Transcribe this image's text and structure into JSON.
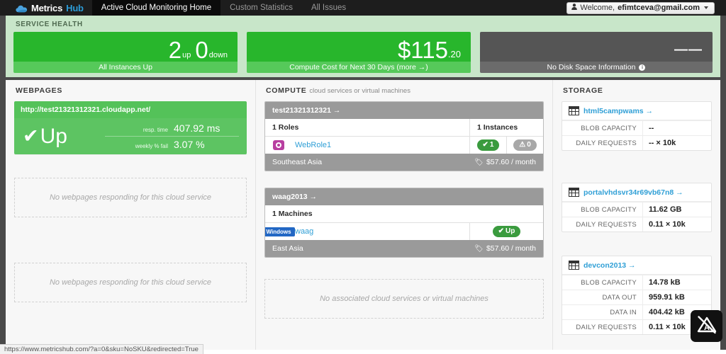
{
  "nav": {
    "brand": "Metrics",
    "brand_accent": "Hub",
    "brand_icon": "cloud-icon",
    "items": [
      {
        "label": "Active Cloud Monitoring Home",
        "active": true
      },
      {
        "label": "Custom Statistics",
        "active": false
      },
      {
        "label": "All Issues",
        "active": false
      }
    ],
    "user": {
      "greeting": "Welcome,",
      "email": "efimtceva@gmail.com",
      "icon": "user-icon"
    }
  },
  "service_health": {
    "title": "SERVICE HEALTH",
    "cards": [
      {
        "kind": "instances",
        "state": "green",
        "up_value": "2",
        "up_unit": "up",
        "down_value": "0",
        "down_unit": "down",
        "footer": "All Instances Up"
      },
      {
        "kind": "cost",
        "state": "green",
        "amount": "$115",
        "cents": ".20",
        "footer": "Compute Cost for Next 30 Days (more →)"
      },
      {
        "kind": "disk",
        "state": "grey",
        "value": "——",
        "footer": "No Disk Space Information",
        "footer_icon": "info-icon"
      }
    ]
  },
  "columns": {
    "webpages": {
      "heading": "WEBPAGES",
      "slots": [
        {
          "type": "card",
          "url": "http://test21321312321.cloudapp.net/",
          "status_icon": "check-icon",
          "status_text": "Up",
          "metrics": [
            {
              "label": "resp. time",
              "value": "407.92 ms"
            },
            {
              "label": "weekly % fail",
              "value": "3.07 %"
            }
          ]
        },
        {
          "type": "placeholder",
          "text": "No webpages responding for this cloud service"
        },
        {
          "type": "placeholder",
          "text": "No webpages responding for this cloud service"
        }
      ]
    },
    "compute": {
      "heading": "COMPUTE",
      "subheading": "cloud services or virtual machines",
      "slots": [
        {
          "type": "card",
          "name": "test21321312321 →",
          "col_left": "1 Roles",
          "col_right": "1 Instances",
          "rows": [
            {
              "icon": "role-icon",
              "name": "WebRole1",
              "badges": [
                {
                  "style": "ok",
                  "icon": "check-icon",
                  "text": "1"
                },
                {
                  "style": "warn",
                  "icon": "warning-icon",
                  "text": "0"
                }
              ]
            }
          ],
          "region": "Southeast Asia",
          "price_icon": "tag-icon",
          "price": "$57.60 / month"
        },
        {
          "type": "card",
          "name": "waag2013 →",
          "col_left": "1 Machines",
          "col_right": "",
          "rows": [
            {
              "os_badge": "Windows",
              "name": "waag",
              "badges": [
                {
                  "style": "ok",
                  "icon": "check-icon",
                  "text": "Up"
                }
              ]
            }
          ],
          "region": "East Asia",
          "price_icon": "tag-icon",
          "price": "$57.60 / month"
        },
        {
          "type": "placeholder",
          "text": "No associated cloud services or virtual machines"
        }
      ]
    },
    "storage": {
      "heading": "STORAGE",
      "slots": [
        {
          "type": "card",
          "icon": "table-icon",
          "name": "html5campwams →",
          "rows": [
            {
              "label": "BLOB CAPACITY",
              "value": "--"
            },
            {
              "label": "DAILY REQUESTS",
              "value": "-- × 10k"
            }
          ]
        },
        {
          "type": "card",
          "icon": "table-icon",
          "name": "portalvhdsvr34r69vb67n8 →",
          "rows": [
            {
              "label": "BLOB CAPACITY",
              "value": "11.62 GB"
            },
            {
              "label": "DAILY REQUESTS",
              "value": "0.11 × 10k"
            }
          ]
        },
        {
          "type": "card",
          "icon": "table-icon",
          "name": "devcon2013 →",
          "rows": [
            {
              "label": "BLOB CAPACITY",
              "value": "14.78 kB"
            },
            {
              "label": "DATA OUT",
              "value": "959.91 kB"
            },
            {
              "label": "DATA IN",
              "value": "404.42 kB"
            },
            {
              "label": "DAILY REQUESTS",
              "value": "0.11 × 10k"
            }
          ]
        }
      ]
    }
  },
  "overlay": {
    "icon": "adblock-icon"
  },
  "statusbar": {
    "url": "https://www.metricshub.com/?a=0&sku=NoSKU&redirected=True"
  },
  "colors": {
    "accent_blue": "#2f9fd6",
    "green": "#28b62c",
    "green_light": "#56c95a",
    "grey_dark": "#4a4a4a",
    "banner_bg": "#c8e6c9",
    "role_purple": "#b83fa0",
    "windows_blue": "#2267c4"
  }
}
